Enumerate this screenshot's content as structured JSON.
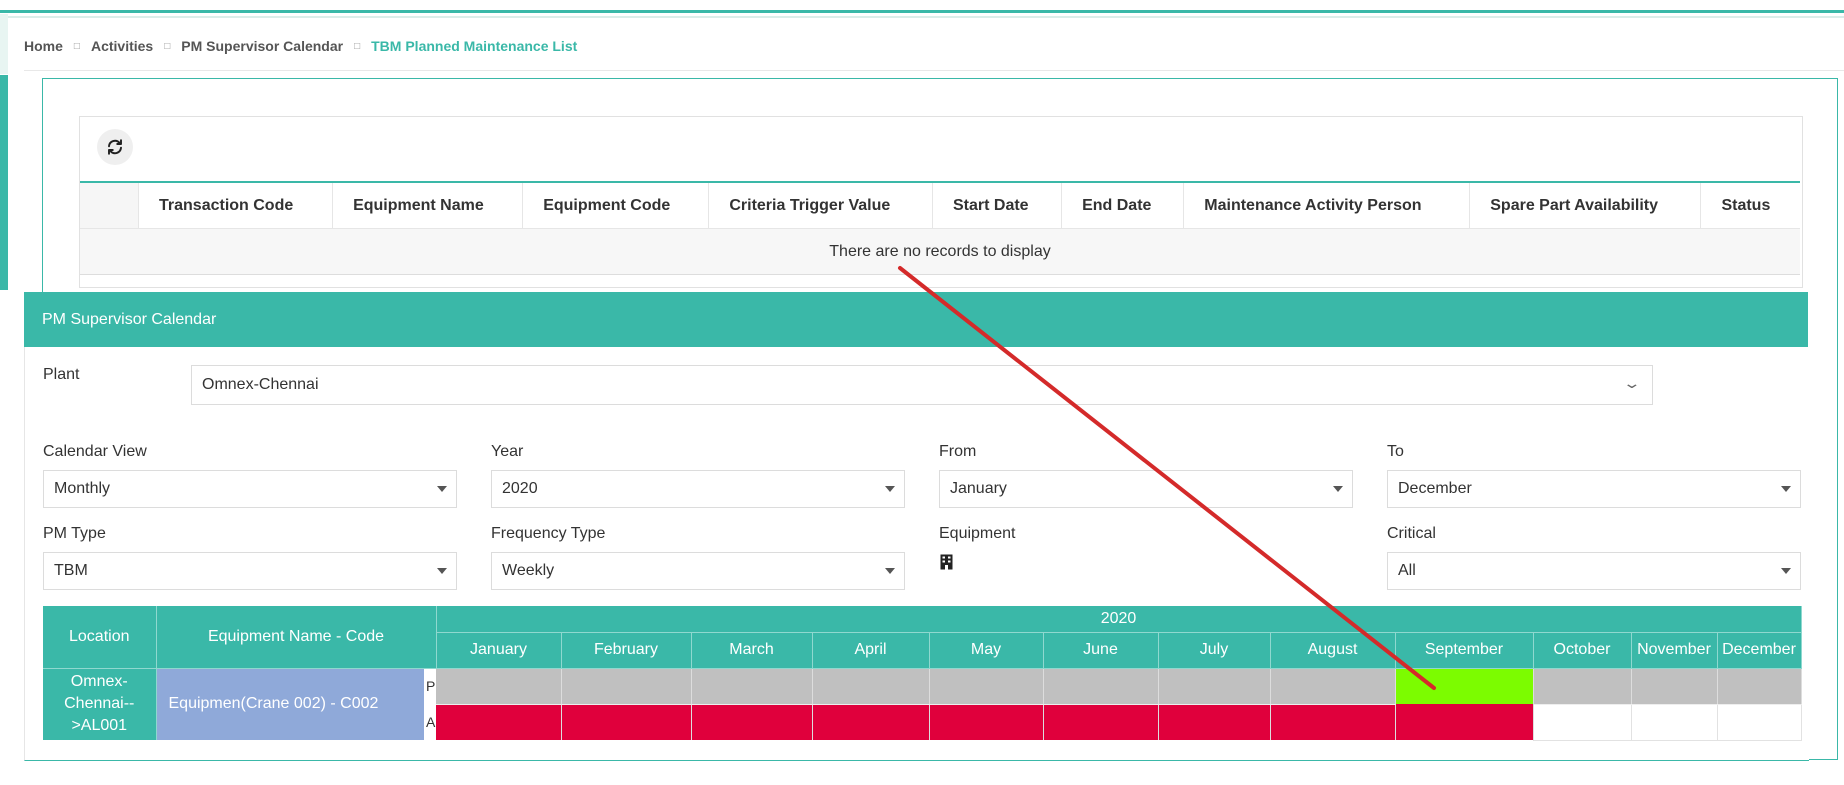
{
  "breadcrumb": {
    "items": [
      "Home",
      "Activities",
      "PM Supervisor Calendar"
    ],
    "active": "TBM Planned Maintenance List",
    "separator": "□"
  },
  "grid": {
    "columns": [
      "Transaction Code",
      "Equipment Name",
      "Equipment Code",
      "Criteria Trigger Value",
      "Start Date",
      "End Date",
      "Maintenance Activity Person",
      "Spare Part Availability",
      "Status"
    ],
    "empty_message": "There are no records to display"
  },
  "calendar_panel": {
    "title": "PM Supervisor Calendar",
    "plant": {
      "label": "Plant",
      "value": "Omnex-Chennai"
    },
    "calendar_view": {
      "label": "Calendar View",
      "value": "Monthly"
    },
    "year": {
      "label": "Year",
      "value": "2020"
    },
    "from": {
      "label": "From",
      "value": "January"
    },
    "to": {
      "label": "To",
      "value": "December"
    },
    "pm_type": {
      "label": "PM Type",
      "value": "TBM"
    },
    "frequency_type": {
      "label": "Frequency Type",
      "value": "Weekly"
    },
    "equipment": {
      "label": "Equipment",
      "icon": "building-icon"
    },
    "critical": {
      "label": "Critical",
      "value": "All"
    }
  },
  "calendar_table": {
    "location_header": "Location",
    "equipment_header": "Equipment Name - Code",
    "year": "2020",
    "months": [
      "January",
      "February",
      "March",
      "April",
      "May",
      "June",
      "July",
      "August",
      "September",
      "October",
      "November",
      "December"
    ],
    "row": {
      "location": "Omnex-Chennai-->AL001",
      "location_lines": [
        "Omnex-",
        "Chennai--",
        ">AL001"
      ],
      "equipment": "Equipmen(Crane 002) - C002",
      "planned_label": "P",
      "actual_label": "A",
      "planned_states": [
        "gray",
        "gray",
        "gray",
        "gray",
        "gray",
        "gray",
        "gray",
        "gray",
        "green",
        "gray",
        "gray",
        "gray"
      ],
      "actual_states": [
        "red",
        "red",
        "red",
        "red",
        "red",
        "red",
        "red",
        "red",
        "red",
        "white",
        "white",
        "white"
      ]
    }
  },
  "colors": {
    "accent": "#3ab8a8",
    "planned_default": "#c0c0c0",
    "planned_highlight": "#7cfc00",
    "actual": "#e0003c",
    "equipment_cell": "#8fa9d9",
    "annotation_arrow": "#d42a2a"
  }
}
